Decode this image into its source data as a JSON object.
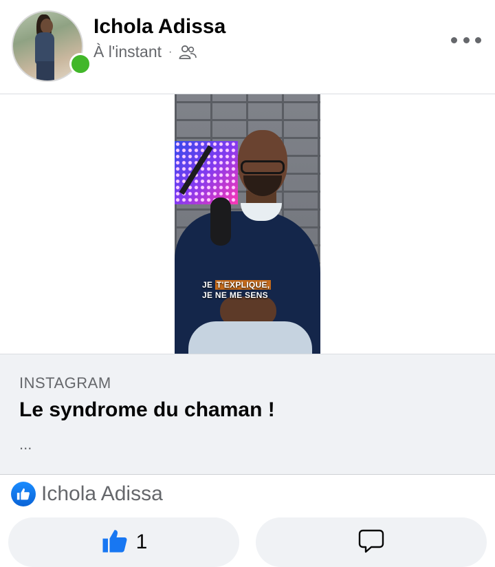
{
  "post": {
    "author": "Ichola Adissa",
    "timestamp": "À l'instant",
    "separator": "·",
    "audience_icon": "friends-icon",
    "more_icon": "more-dots-icon"
  },
  "media": {
    "caption_line1_prefix": "JE ",
    "caption_line1_highlight": "T'EXPLIQUE,",
    "caption_line2": "JE NE ME SENS"
  },
  "link_preview": {
    "source": "INSTAGRAM",
    "title": "Le syndrome du chaman !",
    "description": "..."
  },
  "reactions": {
    "icon": "like-reaction-icon",
    "reactor_name": "Ichola Adissa"
  },
  "actions": {
    "like_icon": "thumbs-up-icon",
    "like_count": "1",
    "comment_icon": "comment-bubble-icon"
  },
  "colors": {
    "accent": "#1877f2",
    "online": "#42b72a",
    "card_bg": "#f0f2f5",
    "muted_text": "#65676b"
  }
}
